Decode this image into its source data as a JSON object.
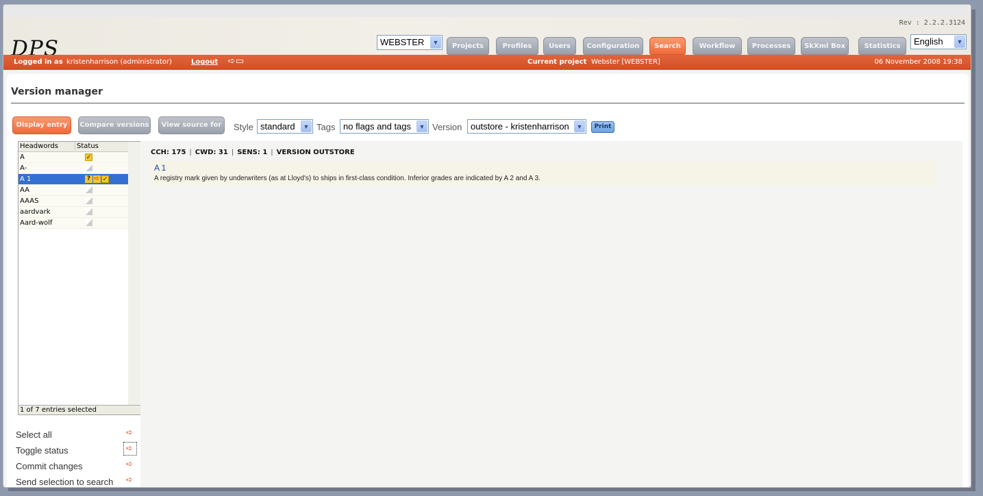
{
  "app": {
    "logo": "DPS",
    "rev": "Rev : 2.2.2.3124",
    "project_select": "WEBSTER",
    "language_select": "English"
  },
  "nav": [
    {
      "label": "Projects"
    },
    {
      "label": "Profiles"
    },
    {
      "label": "Users"
    },
    {
      "label": "Configuration"
    },
    {
      "label": "Search"
    },
    {
      "label": "Workflow"
    },
    {
      "label": "Processes"
    },
    {
      "label": "SkXml Box"
    },
    {
      "label": "Statistics"
    }
  ],
  "statusbar": {
    "logged_in_label": "Logged in as",
    "user": "kristenharrison (administrator)",
    "logout": "Logout",
    "current_project_label": "Current project",
    "current_project": "Webster [WEBSTER]",
    "datetime": "06 November 2008 19:38"
  },
  "page": {
    "title": "Version manager"
  },
  "toolbar": {
    "display_entry": "Display entry",
    "compare_versions": "Compare versions",
    "view_source": "View source for",
    "style_label": "Style",
    "style_value": "standard",
    "tags_label": "Tags",
    "tags_value": "no flags and tags",
    "version_label": "Version",
    "version_value": "outstore - kristenharrison",
    "print": "Print"
  },
  "headwords": {
    "col_headword": "Headwords",
    "col_status": "Status",
    "rows": [
      {
        "hw": "A",
        "status": [
          "check"
        ]
      },
      {
        "hw": "A-",
        "status": [
          "blank"
        ]
      },
      {
        "hw": "A 1",
        "status": [
          "question",
          "arrow",
          "check"
        ],
        "selected": true
      },
      {
        "hw": "AA",
        "status": [
          "blank"
        ]
      },
      {
        "hw": "AAAS",
        "status": [
          "blank"
        ]
      },
      {
        "hw": "aardvark",
        "status": [
          "blank"
        ]
      },
      {
        "hw": "Aard-wolf",
        "status": [
          "blank"
        ]
      }
    ],
    "footer": "1 of 7 entries selected"
  },
  "actions": [
    {
      "label": "Select all"
    },
    {
      "label": "Toggle status"
    },
    {
      "label": "Commit changes"
    },
    {
      "label": "Send selection to search"
    }
  ],
  "entry": {
    "meta": [
      "CCH: 175",
      "CWD: 31",
      "SENS: 1",
      "VERSION OUTSTORE"
    ],
    "headword": "A 1",
    "definition": "A registry mark given by underwriters (as at Lloyd's) to ships in first-class condition. Inferior grades are indicated by A 2 and A 3."
  },
  "colors": {
    "accent": "#e4643a",
    "selection": "#3470d1",
    "link": "#1a3fa8"
  }
}
